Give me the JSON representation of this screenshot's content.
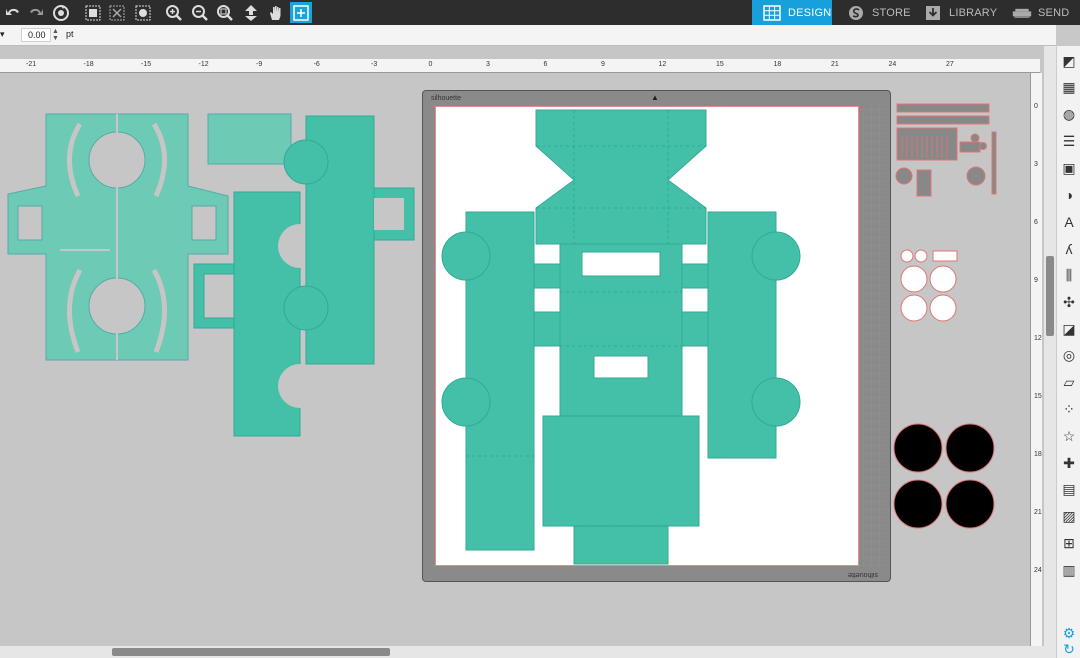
{
  "nav": {
    "design": "DESIGN",
    "store": "STORE",
    "library": "LIBRARY",
    "send": "SEND"
  },
  "options": {
    "line_value": "0.00",
    "unit": "pt"
  },
  "ruler": {
    "top_ticks": [
      "-21",
      "-18",
      "-15",
      "-12",
      "-9",
      "-6",
      "-3",
      "0",
      "3",
      "6",
      "9",
      "12",
      "15",
      "18",
      "21",
      "24",
      "27"
    ],
    "side_ticks": [
      "0",
      "3",
      "6",
      "9",
      "12",
      "15",
      "18",
      "21",
      "24"
    ]
  },
  "mat": {
    "brand_top": "silhouette",
    "brand_bottom": "silhouette"
  },
  "colors": {
    "accent": "#18a0dc",
    "shape_fill": "#44bfa8",
    "shape_light": "#6ccab5",
    "cut_line": "#e07575"
  },
  "toolbar_icons": [
    "undo-icon",
    "redo-icon",
    "rotate-icon",
    "group-icon",
    "ungroup-icon",
    "select-all-icon",
    "zoom-in-icon",
    "zoom-out-icon",
    "zoom-fit-icon",
    "move-down-icon",
    "pan-hand-icon",
    "add-page-icon"
  ],
  "sidebar_icons": [
    "page-setup-icon",
    "pixscan-icon",
    "fill-color-icon",
    "line-style-icon",
    "image-effects-icon",
    "transparency-icon",
    "text-style-icon",
    "sketch-icon",
    "align-icon",
    "replicate-icon",
    "modify-icon",
    "offset-icon",
    "trace-icon",
    "rhinestone-icon",
    "star-icon",
    "puzzle-icon",
    "layers-icon",
    "hatch-icon",
    "nesting-icon",
    "library-panel-icon",
    "settings-gear-icon",
    "sync-icon"
  ]
}
